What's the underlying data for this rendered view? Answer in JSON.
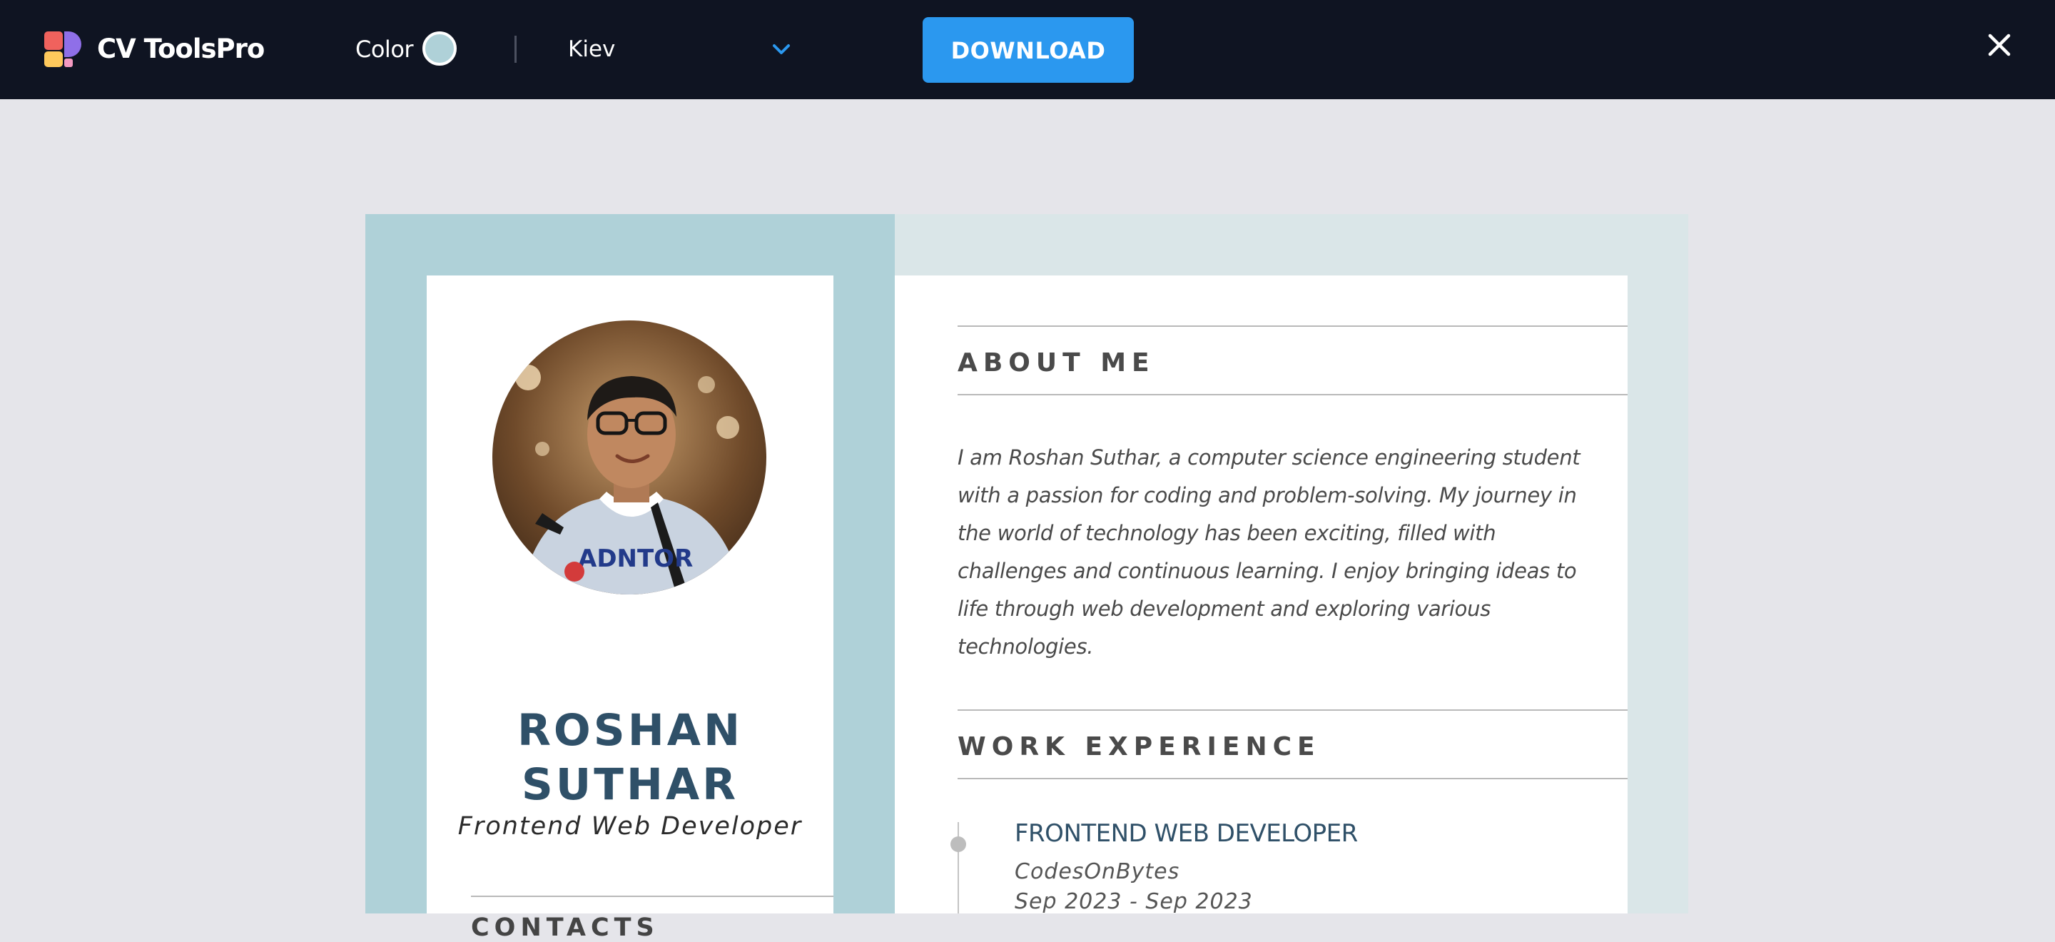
{
  "app": {
    "name": "CV ToolsPro"
  },
  "toolbar": {
    "color_label": "Color",
    "color_value": "#afd1d8",
    "template_selected": "Kiev",
    "download_label": "DOWNLOAD",
    "close_icon": "close-icon"
  },
  "colors": {
    "topbar": "#0f1422",
    "accent": "#2b98ef",
    "sidebar": "#afd1d8",
    "heading_text": "#2f5068"
  },
  "resume": {
    "first_name": "ROSHAN",
    "last_name": "SUTHAR",
    "title": "Frontend Web Developer",
    "contacts_heading": "CONTACTS",
    "about": {
      "heading": "ABOUT ME",
      "text": "I am Roshan Suthar, a computer science engineering student with a passion for coding and problem-solving. My journey in the world of technology has been exciting, filled with challenges and continuous learning. I enjoy bringing ideas to life through web development and exploring various technologies."
    },
    "work": {
      "heading": "WORK EXPERIENCE",
      "items": [
        {
          "role": "FRONTEND WEB DEVELOPER",
          "company": "CodesOnBytes",
          "dates": "Sep 2023 - Sep 2023"
        }
      ]
    }
  }
}
